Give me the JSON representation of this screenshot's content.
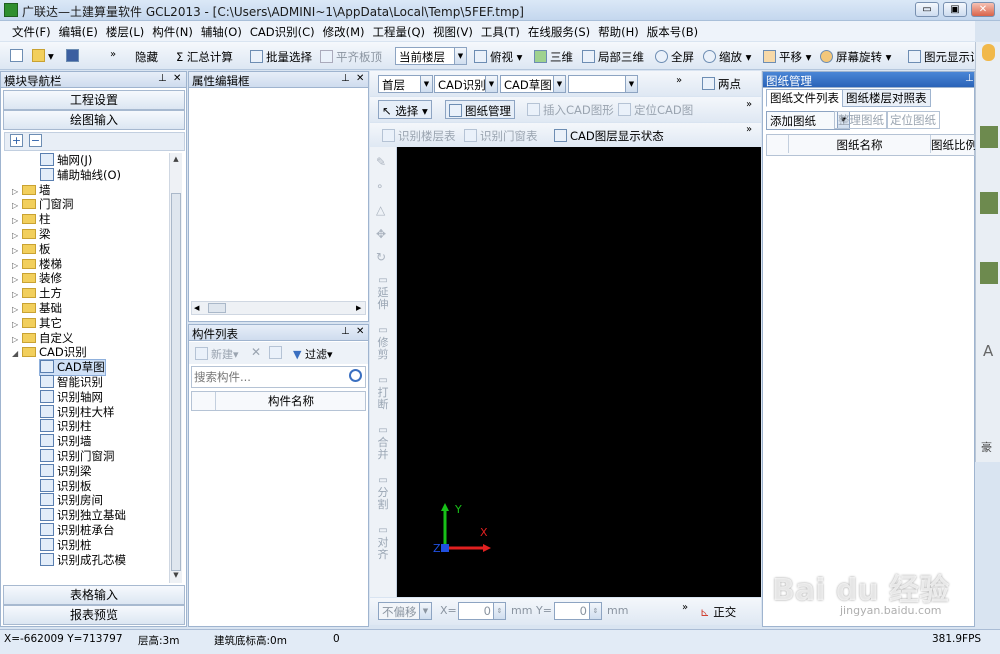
{
  "window": {
    "title": "广联达—土建算量软件 GCL2013 - [C:\\Users\\ADMINI~1\\AppData\\Local\\Temp\\5FEF.tmp]",
    "min": "▭",
    "max": "▣",
    "close": "✕"
  },
  "menu": [
    "文件(F)",
    "编辑(E)",
    "楼层(L)",
    "构件(N)",
    "辅轴(O)",
    "CAD识别(C)",
    "修改(M)",
    "工程量(Q)",
    "视图(V)",
    "工具(T)",
    "在线服务(S)",
    "帮助(H)",
    "版本号(B)"
  ],
  "toolbar1": {
    "hide": "隐藏",
    "sum": "汇总计算",
    "batch": "批量选择",
    "flat": "平齐板顶",
    "floor_select": "当前楼层",
    "view": "俯视",
    "three_d": "三维",
    "local_3d": "局部三维",
    "fullscreen": "全屏",
    "zoom": "缩放",
    "pan": "平移",
    "rotate": "屏幕旋转",
    "display": "图元显示设"
  },
  "nav": {
    "title": "模块导航栏",
    "setup": "工程设置",
    "draw": "绘图输入",
    "table_input": "表格输入",
    "report": "报表预览",
    "items": [
      {
        "label": "轴网(J)",
        "level": 2,
        "icon": "grid-icon"
      },
      {
        "label": "辅助轴线(O)",
        "level": 2,
        "icon": "aux-axis-icon"
      },
      {
        "label": "墙",
        "level": 1
      },
      {
        "label": "门窗洞",
        "level": 1
      },
      {
        "label": "柱",
        "level": 1
      },
      {
        "label": "梁",
        "level": 1
      },
      {
        "label": "板",
        "level": 1
      },
      {
        "label": "楼梯",
        "level": 1
      },
      {
        "label": "装修",
        "level": 1
      },
      {
        "label": "土方",
        "level": 1
      },
      {
        "label": "基础",
        "level": 1
      },
      {
        "label": "其它",
        "level": 1
      },
      {
        "label": "自定义",
        "level": 1
      },
      {
        "label": "CAD识别",
        "level": 1,
        "open": true
      },
      {
        "label": "CAD草图",
        "level": 2,
        "icon": "cad-icon",
        "selected": true
      },
      {
        "label": "智能识别",
        "level": 2,
        "icon": "smart-icon"
      },
      {
        "label": "识别轴网",
        "level": 2,
        "icon": "grid-icon"
      },
      {
        "label": "识别柱大样",
        "level": 2,
        "icon": "cad-icon"
      },
      {
        "label": "识别柱",
        "level": 2,
        "icon": "column-icon"
      },
      {
        "label": "识别墙",
        "level": 2,
        "icon": "wall-icon"
      },
      {
        "label": "识别门窗洞",
        "level": 2,
        "icon": "door-icon"
      },
      {
        "label": "识别梁",
        "level": 2,
        "icon": "beam-icon"
      },
      {
        "label": "识别板",
        "level": 2,
        "icon": "slab-icon"
      },
      {
        "label": "识别房间",
        "level": 2,
        "icon": "room-icon"
      },
      {
        "label": "识别独立基础",
        "level": 2,
        "icon": "foundation-icon"
      },
      {
        "label": "识别桩承台",
        "level": 2,
        "icon": "pile-cap-icon"
      },
      {
        "label": "识别桩",
        "level": 2,
        "icon": "pile-icon"
      },
      {
        "label": "识别成孔芯模",
        "level": 2,
        "icon": "cad-icon"
      }
    ]
  },
  "props": {
    "title": "属性编辑框"
  },
  "comp": {
    "title": "构件列表",
    "new": "新建",
    "filter": "过滤",
    "search_placeholder": "搜索构件...",
    "col_name": "构件名称"
  },
  "cadbar": {
    "floor": "首层",
    "cad_recog": "CAD识别",
    "cad_draft": "CAD草图",
    "two_points": "两点",
    "select": "选择",
    "drawing_mgmt": "图纸管理",
    "insert_cad": "插入CAD图形",
    "locate_cad": "定位CAD图",
    "recog_floor_table": "识别楼层表",
    "recog_door_table": "识别门窗表",
    "layer_state": "CAD图层显示状态"
  },
  "side_tools": [
    "延伸",
    "修剪",
    "打断",
    "合并",
    "分割",
    "对齐"
  ],
  "coordbar": {
    "offset": "不偏移",
    "x_label": "X=",
    "x_val": "0",
    "y_label": "Y=",
    "y_val": "0",
    "unit": "mm",
    "ortho": "正交"
  },
  "drawing": {
    "title": "图纸管理",
    "tab1": "图纸文件列表",
    "tab2": "图纸楼层对照表",
    "add": "添加图纸",
    "tidy": "整理图纸",
    "locate": "定位图纸",
    "col_name": "图纸名称",
    "col_scale": "图纸比例"
  },
  "status": {
    "coords": "X=-662009 Y=713797",
    "floor_height": "层高:3m",
    "base_elev": "建筑底标高:0m",
    "zero": "0",
    "fps": "381.9FPS"
  },
  "axes": {
    "x": "X",
    "y": "Y",
    "z": "Z"
  },
  "watermark": {
    "text": "Bai du 经验",
    "sub": "jingyan.baidu.com"
  },
  "colors": {
    "axis_x": "#e02020",
    "axis_y": "#18c018",
    "axis_z": "#2050e0",
    "canvas": "#000000"
  }
}
